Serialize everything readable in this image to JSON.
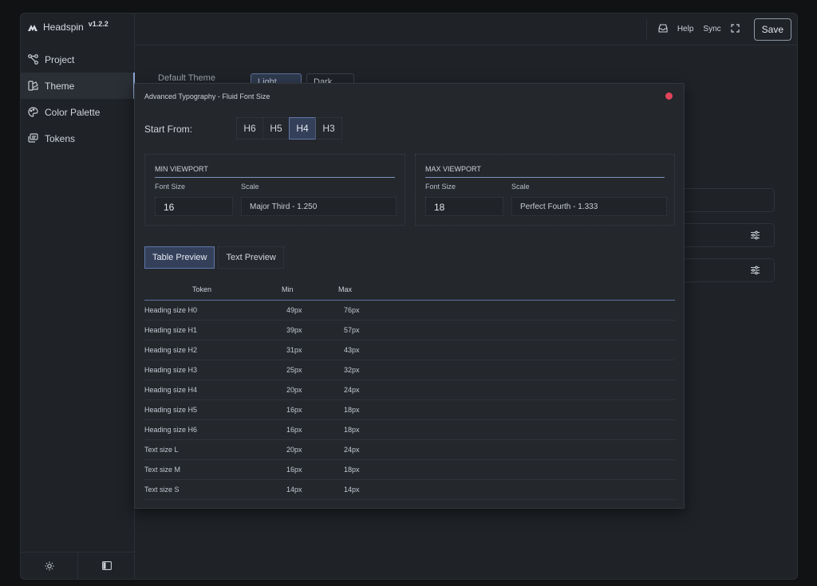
{
  "app": {
    "name": "Headspin",
    "version": "v1.2.2"
  },
  "sidebar": {
    "items": [
      {
        "label": "Project",
        "icon": "project-icon"
      },
      {
        "label": "Theme",
        "icon": "theme-icon",
        "active": true
      },
      {
        "label": "Color Palette",
        "icon": "palette-icon"
      },
      {
        "label": "Tokens",
        "icon": "tokens-icon"
      }
    ],
    "bottom": [
      "sun-icon",
      "panel-toggle-icon"
    ]
  },
  "header": {
    "help": "Help",
    "sync": "Sync",
    "save": "Save"
  },
  "background": {
    "default_theme": "Default Theme",
    "light": "Light",
    "dark": "Dark"
  },
  "modal": {
    "title": "Advanced Typography - Fluid Font Size",
    "start_from": "Start From:",
    "heading_tabs": [
      {
        "label": "H6"
      },
      {
        "label": "H5"
      },
      {
        "label": "H4",
        "active": true
      },
      {
        "label": "H3"
      }
    ],
    "min_viewport": {
      "title": "MIN VIEWPORT",
      "font_size_label": "Font Size",
      "scale_label": "Scale",
      "font_size": "16",
      "scale": "Major Third - 1.250"
    },
    "max_viewport": {
      "title": "MAX VIEWPORT",
      "font_size_label": "Font Size",
      "scale_label": "Scale",
      "font_size": "18",
      "scale": "Perfect Fourth - 1.333"
    },
    "preview_tabs": [
      {
        "label": "Table Preview",
        "active": true
      },
      {
        "label": "Text Preview"
      }
    ],
    "table": {
      "headers": [
        "Token",
        "Min",
        "Max"
      ],
      "rows": [
        [
          "Heading size H0",
          "49px",
          "76px"
        ],
        [
          "Heading size H1",
          "39px",
          "57px"
        ],
        [
          "Heading size H2",
          "31px",
          "43px"
        ],
        [
          "Heading size H3",
          "25px",
          "32px"
        ],
        [
          "Heading size H4",
          "20px",
          "24px"
        ],
        [
          "Heading size H5",
          "16px",
          "18px"
        ],
        [
          "Heading size H6",
          "16px",
          "18px"
        ],
        [
          "Text size L",
          "20px",
          "24px"
        ],
        [
          "Text size M",
          "16px",
          "18px"
        ],
        [
          "Text size S",
          "14px",
          "14px"
        ]
      ]
    }
  },
  "colors": {
    "accent": "#5f77a8",
    "close": "#e0445a",
    "background": "#1f2227"
  }
}
